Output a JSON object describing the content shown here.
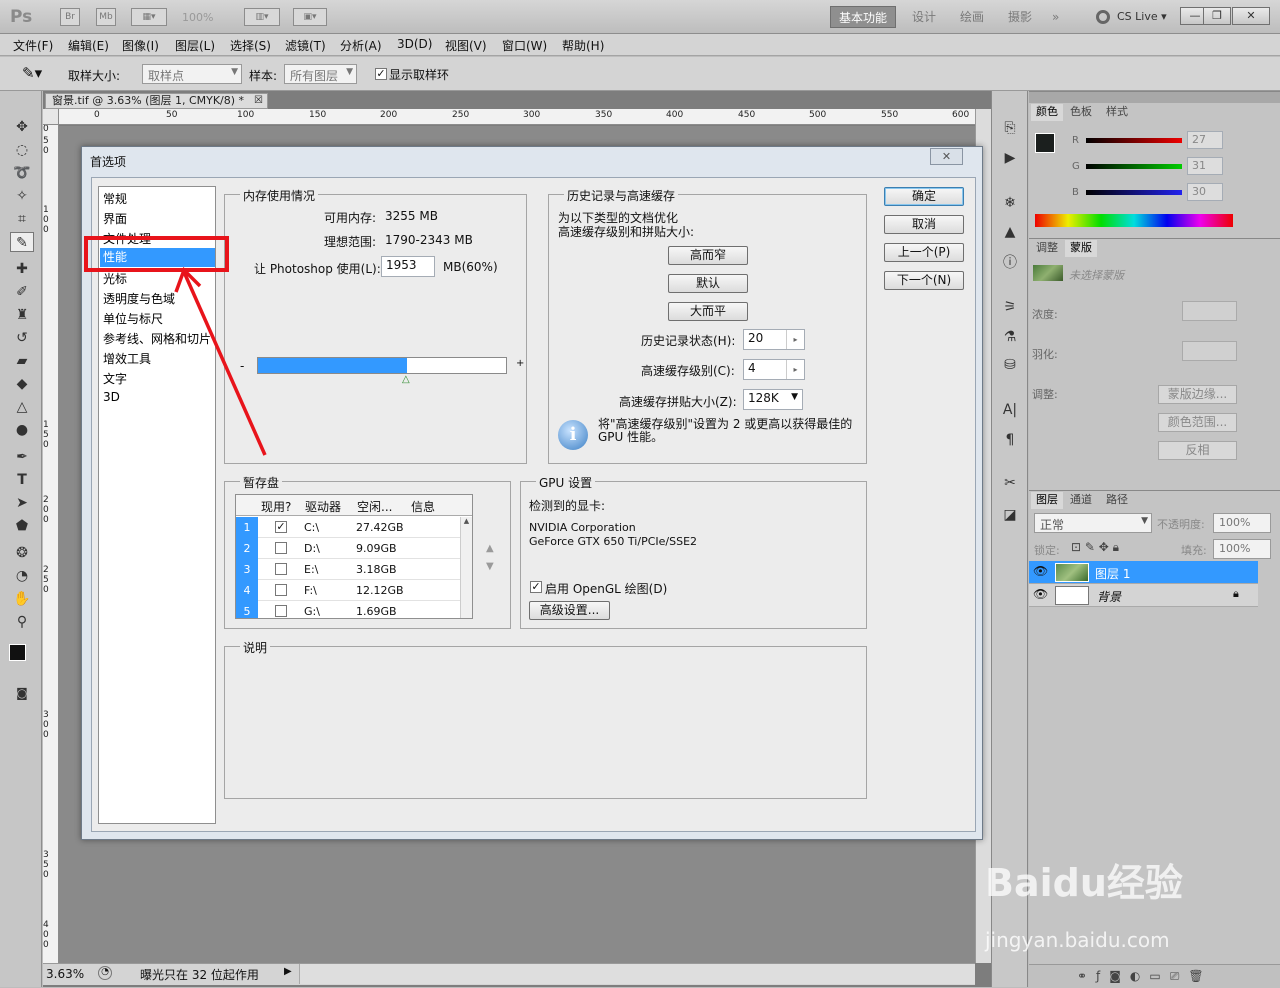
{
  "app": {
    "logo": "Ps",
    "zoom_value": "100%",
    "br": "Br",
    "mb": "Mb"
  },
  "workspaces": {
    "active": "基本功能",
    "items": [
      "设计",
      "绘画",
      "摄影"
    ],
    "cs_live": "CS Live"
  },
  "menu": [
    "文件(F)",
    "编辑(E)",
    "图像(I)",
    "图层(L)",
    "选择(S)",
    "滤镜(T)",
    "分析(A)",
    "3D(D)",
    "视图(V)",
    "窗口(W)",
    "帮助(H)"
  ],
  "options": {
    "sample_size_label": "取样大小:",
    "sample_size_value": "取样点",
    "sample_label": "样本:",
    "sample_value": "所有图层",
    "show_ring": "显示取样环"
  },
  "document": {
    "tab_title": "窗景.tif @ 3.63% (图层 1, CMYK/8) *",
    "ruler_h": [
      "0",
      "50",
      "100",
      "150",
      "200",
      "250",
      "300",
      "350",
      "400",
      "450",
      "500",
      "550",
      "600"
    ],
    "ruler_v": [
      "0",
      "5\n0",
      "1\n0\n0",
      "1\n5\n0",
      "2\n0\n0",
      "2\n5\n0",
      "3\n0\n0",
      "3\n5\n0",
      "4\n0\n0"
    ]
  },
  "status": {
    "zoom": "3.63%",
    "message": "曝光只在 32 位起作用"
  },
  "dialog": {
    "title": "首选项",
    "nav": [
      "常规",
      "界面",
      "文件处理",
      "性能",
      "光标",
      "透明度与色域",
      "单位与标尺",
      "参考线、网格和切片",
      "增效工具",
      "文字",
      "3D"
    ],
    "nav_selected": "性能",
    "memory": {
      "title": "内存使用情况",
      "available_label": "可用内存:",
      "available": "3255 MB",
      "ideal_label": "理想范围:",
      "ideal": "1790-2343 MB",
      "use_label": "让 Photoshop 使用(L):",
      "use_value": "1953",
      "use_unit": "MB(60%)",
      "minus": "-",
      "plus": "+",
      "slider_fraction": 0.6
    },
    "history": {
      "title": "历史记录与高速缓存",
      "desc1": "为以下类型的文档优化",
      "desc2": "高速缓存级别和拼贴大小:",
      "btn_tall": "高而窄",
      "btn_default": "默认",
      "btn_big": "大而平",
      "states_label": "历史记录状态(H):",
      "states": "20",
      "levels_label": "高速缓存级别(C):",
      "levels": "4",
      "tile_label": "高速缓存拼贴大小(Z):",
      "tile": "128K",
      "info": "将\"高速缓存级别\"设置为 2 或更高以获得最佳的 GPU 性能。"
    },
    "buttons": {
      "ok": "确定",
      "cancel": "取消",
      "prev": "上一个(P)",
      "next": "下一个(N)"
    },
    "scratch": {
      "title": "暂存盘",
      "headers": [
        "现用?",
        "驱动器",
        "空闲...",
        "信息"
      ],
      "rows": [
        {
          "n": "1",
          "active": true,
          "drive": "C:\\",
          "free": "27.42GB"
        },
        {
          "n": "2",
          "active": false,
          "drive": "D:\\",
          "free": "9.09GB"
        },
        {
          "n": "3",
          "active": false,
          "drive": "E:\\",
          "free": "3.18GB"
        },
        {
          "n": "4",
          "active": false,
          "drive": "F:\\",
          "free": "12.12GB"
        },
        {
          "n": "5",
          "active": false,
          "drive": "G:\\",
          "free": "1.69GB"
        }
      ]
    },
    "gpu": {
      "title": "GPU 设置",
      "detected": "检测到的显卡:",
      "vendor": "NVIDIA Corporation",
      "model": "GeForce GTX 650 Ti/PCIe/SSE2",
      "opengl": "启用 OpenGL 绘图(D)",
      "advanced": "高级设置..."
    },
    "desc": {
      "title": "说明"
    }
  },
  "panels": {
    "color": {
      "tabs": [
        "颜色",
        "色板",
        "样式"
      ],
      "r_label": "R",
      "g_label": "G",
      "b_label": "B",
      "r": "27",
      "g": "31",
      "b": "30"
    },
    "adjust": {
      "tabs": [
        "调整",
        "蒙版"
      ],
      "none": "未选择蒙版",
      "density": "浓度:",
      "feather": "羽化:",
      "refine": "调整:",
      "mask_edge": "蒙版边缘...",
      "color_range": "颜色范围...",
      "invert": "反相"
    },
    "layers": {
      "tabs": [
        "图层",
        "通道",
        "路径"
      ],
      "mode": "正常",
      "opacity_label": "不透明度:",
      "opacity": "100%",
      "lock_label": "锁定:",
      "fill_label": "填充:",
      "fill": "100%",
      "items": [
        {
          "name": "图层 1"
        },
        {
          "name": "背景"
        }
      ]
    }
  },
  "watermark": {
    "text": "Baidu经验",
    "url": "jingyan.baidu.com"
  },
  "colors": {
    "accent": "#3399ff",
    "annotation": "#e8141b"
  }
}
